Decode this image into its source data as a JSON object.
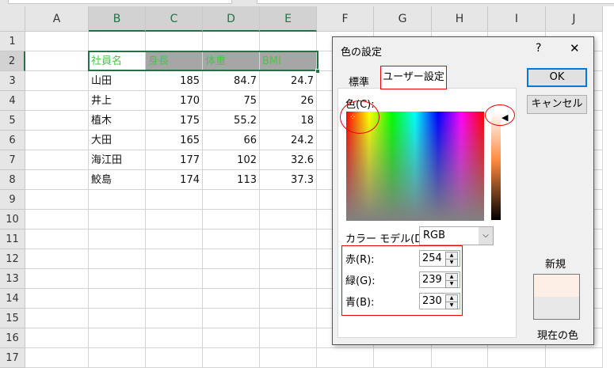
{
  "sheet": {
    "columns": [
      "A",
      "B",
      "C",
      "D",
      "E",
      "F",
      "G",
      "H",
      "I",
      "J"
    ],
    "rows": [
      "1",
      "2",
      "3",
      "4",
      "5",
      "6",
      "7",
      "8",
      "9",
      "10",
      "11",
      "12",
      "13",
      "14",
      "15",
      "16",
      "17"
    ],
    "header": [
      "社員名",
      "身長",
      "体重",
      "BMI"
    ],
    "data": [
      [
        "山田",
        "185",
        "84.7",
        "24.7"
      ],
      [
        "井上",
        "170",
        "75",
        "26"
      ],
      [
        "植木",
        "175",
        "55.2",
        "18"
      ],
      [
        "大田",
        "165",
        "66",
        "24.2"
      ],
      [
        "海江田",
        "177",
        "102",
        "32.6"
      ],
      [
        "鮫島",
        "174",
        "113",
        "37.3"
      ]
    ]
  },
  "dialog": {
    "title": "色の設定",
    "help": "?",
    "close": "✕",
    "tabs": [
      "標準",
      "ユーザー設定"
    ],
    "color_label": "色(C):",
    "model_label": "カラー モデル(D):",
    "model_value": "RGB",
    "red_label": "赤(R):",
    "red": "254",
    "green_label": "緑(G):",
    "green": "239",
    "blue_label": "青(B):",
    "blue": "230",
    "ok": "OK",
    "cancel": "キャンセル",
    "new_label": "新規",
    "current_label": "現在の色",
    "new_color": "#FEEFE6",
    "current_color": "#E8E8E8"
  }
}
